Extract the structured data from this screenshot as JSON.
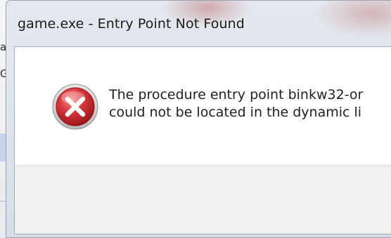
{
  "background_app": {
    "fragments": [
      "a",
      "G"
    ]
  },
  "dialog": {
    "title": "game.exe - Entry Point Not Found",
    "icon": "error-icon",
    "message_line_1": "The procedure entry point binkw32-or",
    "message_line_2": "could not be located in the dynamic li"
  },
  "colors": {
    "icon_red": "#c8262e",
    "button_area_bg": "#f0f0f0",
    "frame_bg": "#dde3ea"
  }
}
